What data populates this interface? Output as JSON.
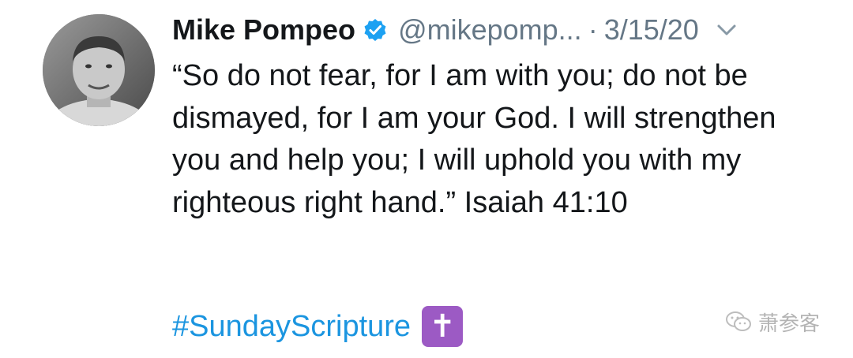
{
  "tweet": {
    "author_name": "Mike Pompeo",
    "handle": "@mikepomp...",
    "separator": "·",
    "date": "3/15/20",
    "text": "“So do not fear, for I am with you; do not be dismayed, for I am your God. I will strengthen you and help you; I will uphold you with my righteous right hand.” Isaiah 41:10",
    "hashtag": "#SundayScripture",
    "emoji": "✝"
  },
  "icons": {
    "verified": "verified-badge-icon",
    "menu": "chevron-down-icon",
    "watermark": "wechat-icon"
  },
  "watermark": {
    "text": "萧参客"
  },
  "colors": {
    "text": "#14171a",
    "secondary": "#657786",
    "link": "#1b95e0",
    "verified": "#1da1f2",
    "emoji_bg": "#9c5ac4"
  }
}
